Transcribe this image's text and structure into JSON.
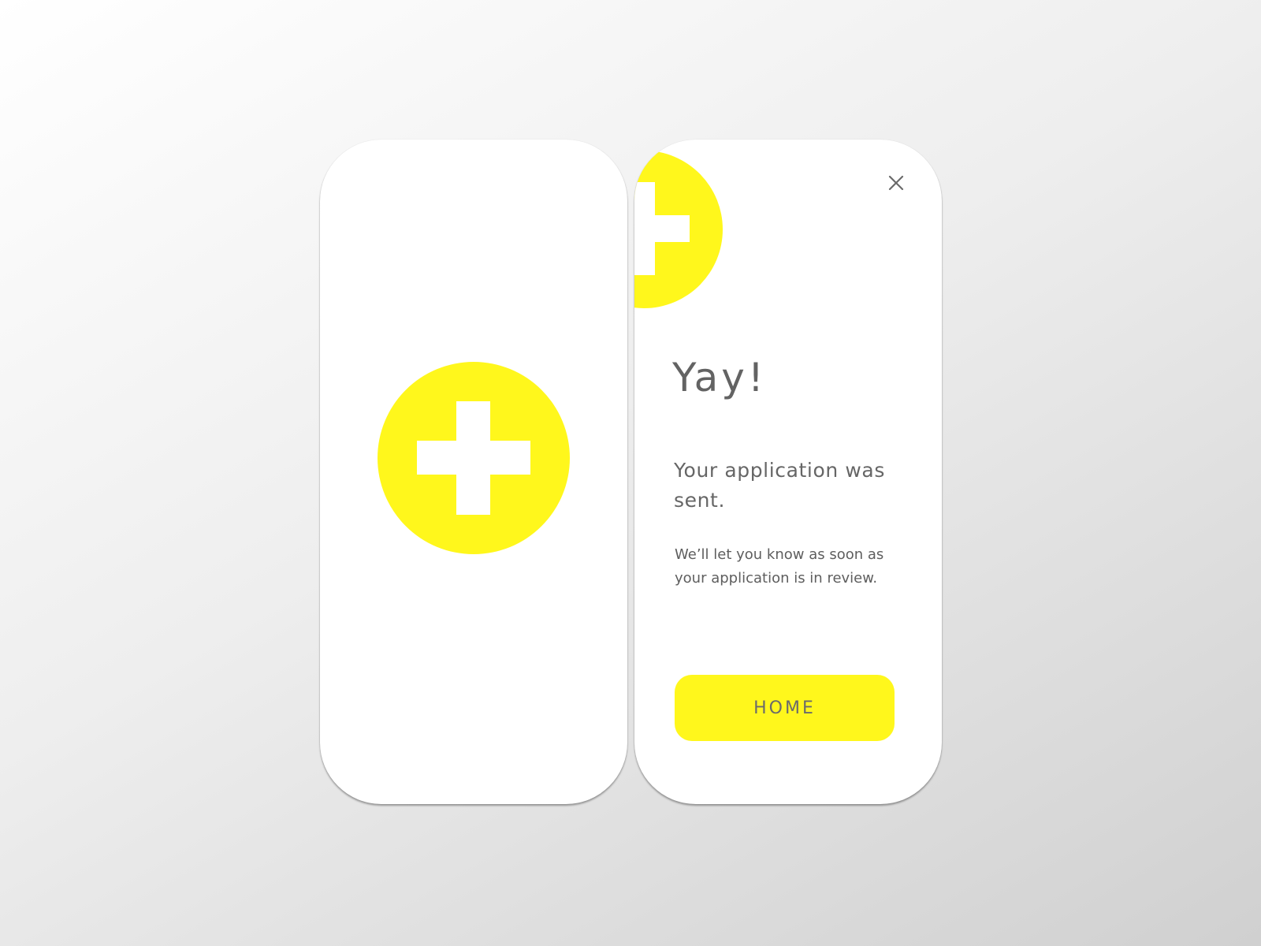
{
  "colors": {
    "accent": "#fff71c",
    "text": "#636363",
    "screen_background": "#ffffff"
  },
  "splash_screen": {
    "logo_icon": "plus-circle-icon"
  },
  "confirmation_screen": {
    "logo_icon": "plus-circle-icon",
    "close_icon": "close-icon",
    "title": "Yay!",
    "subtitle": "Your application was sent.",
    "message": "We’ll let you know as soon as your application is in review.",
    "home_button_label": "HOME"
  }
}
